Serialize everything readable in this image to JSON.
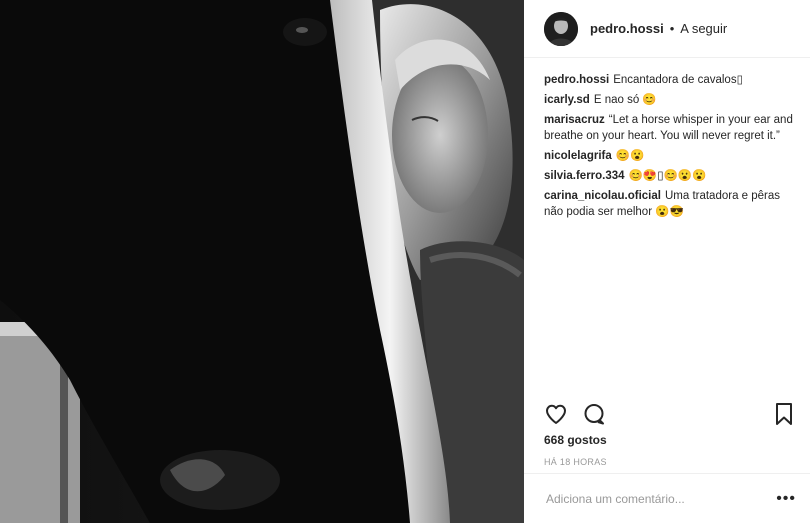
{
  "post": {
    "username": "pedro.hossi",
    "separator": "•",
    "follow_label": "A seguir"
  },
  "comments": [
    {
      "user": "pedro.hossi",
      "text": "Encantadora de cavalos▯"
    },
    {
      "user": "icarly.sd",
      "text": "E nao só 😊"
    },
    {
      "user": "marisacruz",
      "text": "“Let a horse whisper in your ear and breathe on your heart. You will never regret it.”"
    },
    {
      "user": "nicolelagrifa",
      "text": "😊😮"
    },
    {
      "user": "silvia.ferro.334",
      "text": "😊😍▯😊😮😮"
    },
    {
      "user": "carina_nicolau.oficial",
      "text": "Uma tratadora e pêras não podia ser melhor 😮😎"
    }
  ],
  "likes_label": "668 gostos",
  "time_label": "HÁ 18 HORAS",
  "add_comment": {
    "placeholder": "Adiciona um comentário..."
  },
  "more_label": "•••",
  "icons": [
    "heart-icon",
    "comment-icon",
    "bookmark-icon"
  ]
}
